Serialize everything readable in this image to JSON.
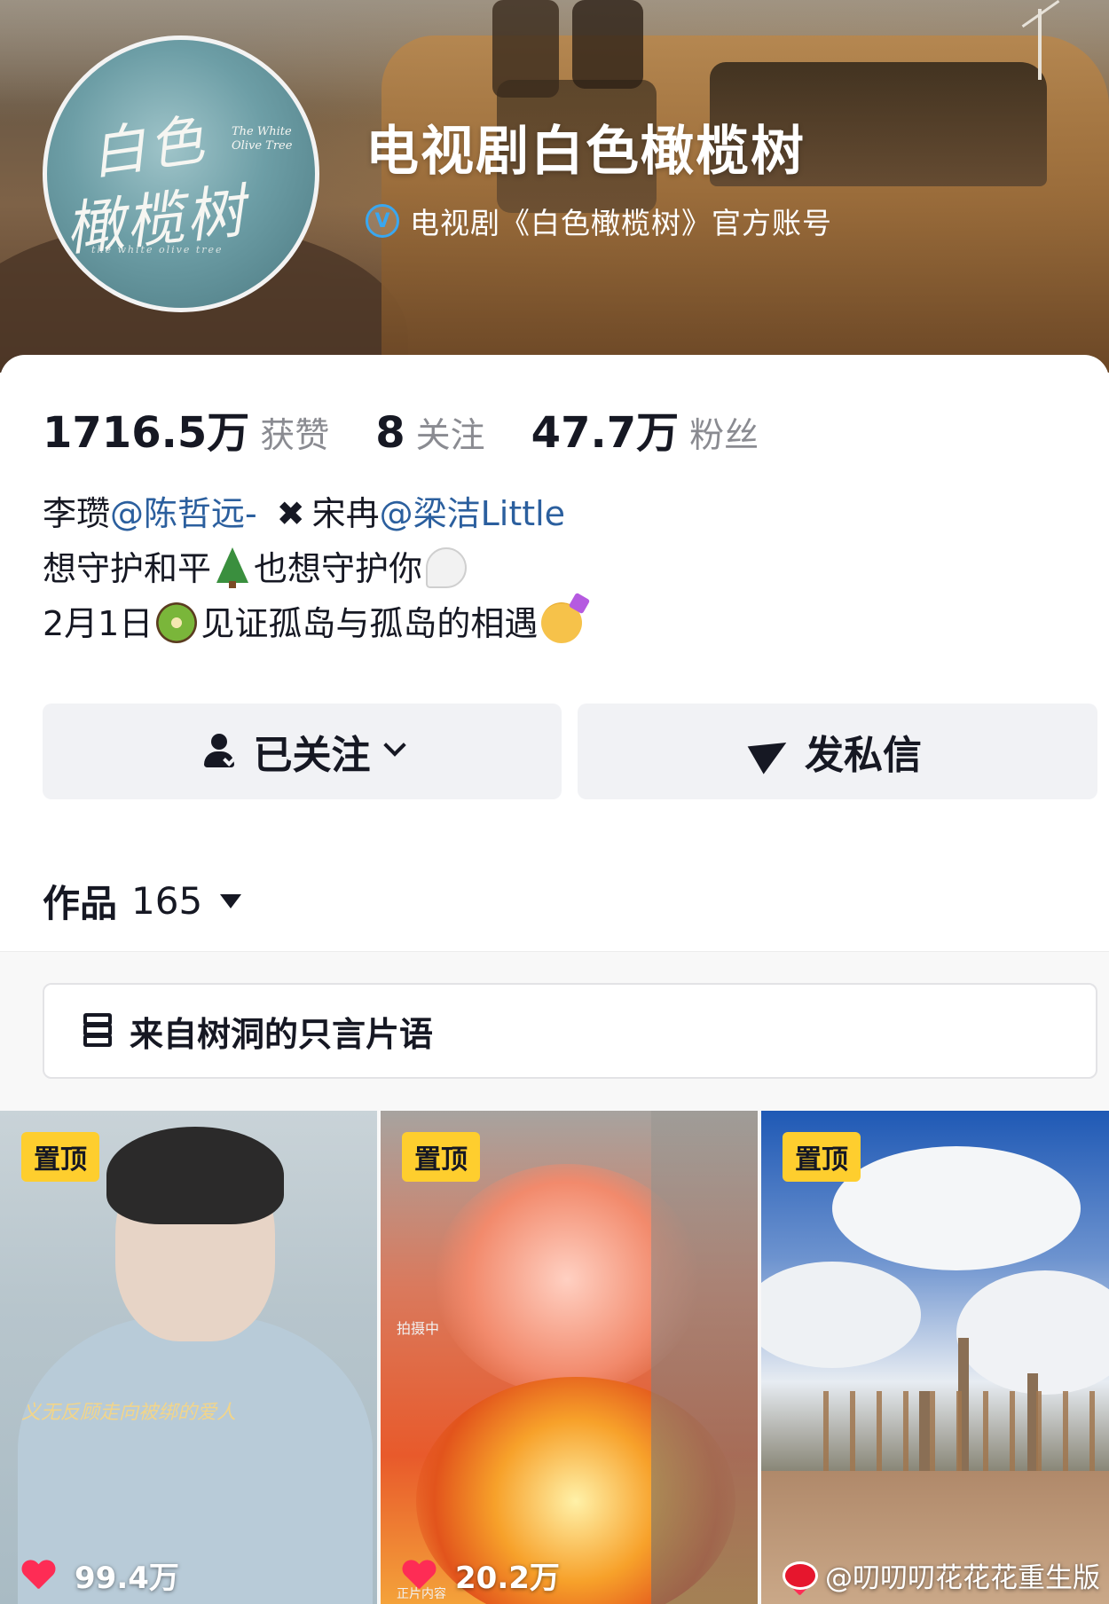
{
  "header": {
    "title": "电视剧白色橄榄树",
    "verified_icon": "V",
    "verified_text": "电视剧《白色橄榄树》官方账号",
    "avatar": {
      "logo_main_1": "白色",
      "logo_main_2": "橄榄树",
      "logo_en": "The White Olive Tree",
      "logo_sub": "the white olive tree"
    }
  },
  "stats": [
    {
      "value": "1716.5万",
      "label": "获赞"
    },
    {
      "value": "8",
      "label": "关注"
    },
    {
      "value": "47.7万",
      "label": "粉丝"
    }
  ],
  "bio": {
    "line1_a": "李瓒",
    "mention1": "@陈哲远-",
    "cross": "✖",
    "line1_b": "宋冉",
    "mention2": "@梁洁Little",
    "line2_a": "想守护和平",
    "line2_b": "也想守护你",
    "line3_a": "2月1日",
    "line3_b": "见证孤岛与孤岛的相遇"
  },
  "actions": {
    "follow_label": "已关注",
    "message_label": "发私信"
  },
  "works": {
    "label": "作品",
    "count": "165"
  },
  "collection": {
    "label": "来自树洞的只言片语"
  },
  "videos": [
    {
      "pin": "置顶",
      "likes": "99.4万",
      "caption": "义无反顾走向被绑的爱人"
    },
    {
      "pin": "置顶",
      "likes": "20.2万",
      "caption": "拍摄中",
      "caption2": "正片内容"
    },
    {
      "pin": "置顶",
      "likes": ""
    }
  ],
  "watermark": {
    "text": "@叨叨叨花花花重生版"
  },
  "colors": {
    "accent_red": "#fe2c55",
    "pin_yellow": "#fece2e",
    "mention_blue": "#2b5f9e",
    "verified_blue": "#39a7f0"
  }
}
